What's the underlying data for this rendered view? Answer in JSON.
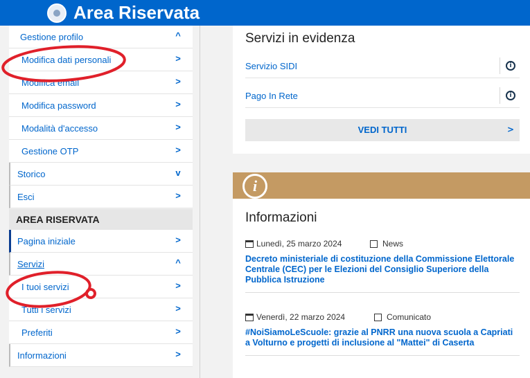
{
  "header": {
    "title": "Area Riservata"
  },
  "sidebar": {
    "profile_items": [
      {
        "label": "Gestione profilo",
        "chevron": "^"
      },
      {
        "label": "Modifica dati personali",
        "chevron": ">"
      },
      {
        "label": "Modifica email",
        "chevron": ">"
      },
      {
        "label": "Modifica password",
        "chevron": ">"
      },
      {
        "label": "Modalità d'accesso",
        "chevron": ">"
      },
      {
        "label": "Gestione OTP",
        "chevron": ">"
      },
      {
        "label": "Storico",
        "chevron": "v"
      },
      {
        "label": "Esci",
        "chevron": ">"
      }
    ],
    "section_title": "AREA RISERVATA",
    "area_items": [
      {
        "label": "Pagina iniziale",
        "chevron": ">"
      },
      {
        "label": "Servizi",
        "chevron": "^"
      },
      {
        "label": "I tuoi servizi",
        "chevron": ">"
      },
      {
        "label": "Tutti i servizi",
        "chevron": ">"
      },
      {
        "label": "Preferiti",
        "chevron": ">"
      },
      {
        "label": "Informazioni",
        "chevron": ">"
      }
    ]
  },
  "featured": {
    "heading": "Servizi in evidenza",
    "services": [
      {
        "name": "Servizio SIDI",
        "icon": "info-icon"
      },
      {
        "name": "Pago In Rete",
        "icon": "info-icon"
      }
    ],
    "see_all": "VEDI TUTTI",
    "see_all_chevron": ">"
  },
  "info": {
    "heading": "Informazioni",
    "band_icon": "i",
    "band_color": "#c49a63",
    "news": [
      {
        "date": "Lunedì, 25 marzo 2024",
        "tag": "News",
        "title": "Decreto ministeriale di costituzione della Commissione Elettorale Centrale (CEC) per le Elezioni del Consiglio Superiore della Pubblica Istruzione"
      },
      {
        "date": "Venerdì, 22 marzo 2024",
        "tag": "Comunicato",
        "title": "#NoiSiamoLeScuole: grazie al PNRR una nuova scuola a Capriati a Volturno e progetti di inclusione al \"Mattei\" di Caserta"
      }
    ]
  },
  "colors": {
    "brand_blue": "#0066cc",
    "annotation_red": "#e0202a"
  }
}
